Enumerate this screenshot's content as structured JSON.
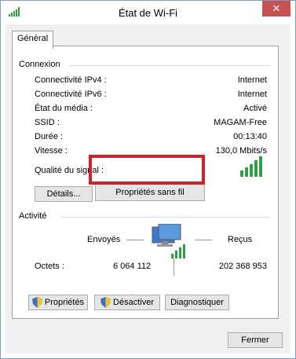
{
  "window": {
    "title": "État de Wi-Fi",
    "close_glyph": "✕"
  },
  "tabs": [
    {
      "label": "Général",
      "selected": true
    }
  ],
  "connection": {
    "group_label": "Connexion",
    "rows": [
      {
        "label": "Connectivité IPv4 :",
        "value": "Internet"
      },
      {
        "label": "Connectivité IPv6 :",
        "value": "Internet"
      },
      {
        "label": "État du média :",
        "value": "Activé"
      },
      {
        "label": "SSID :",
        "value": "MAGAM-Free"
      },
      {
        "label": "Durée :",
        "value": "00:13:40"
      },
      {
        "label": "Vitesse :",
        "value": "130,0 Mbits/s"
      }
    ],
    "signal_label": "Qualité du signal :",
    "signal_bars": 5,
    "details_button": "Détails...",
    "wireless_props_button": "Propriétés sans fil"
  },
  "activity": {
    "group_label": "Activité",
    "sent_label": "Envoyés",
    "received_label": "Reçus",
    "bytes_label": "Octets :",
    "bytes_sent": "6 064 112",
    "bytes_received": "202 368 953"
  },
  "actions": {
    "properties": "Propriétés",
    "disable": "Désactiver",
    "diagnose": "Diagnostiquer"
  },
  "footer": {
    "close_button": "Fermer"
  },
  "icons": {
    "title": "wifi-signal-icon",
    "network": "network-computer-icon",
    "shield": "uac-shield-icon"
  },
  "colors": {
    "signal_green": "#2ea043",
    "highlight": "#d0202a",
    "close_red": "#c75050"
  }
}
